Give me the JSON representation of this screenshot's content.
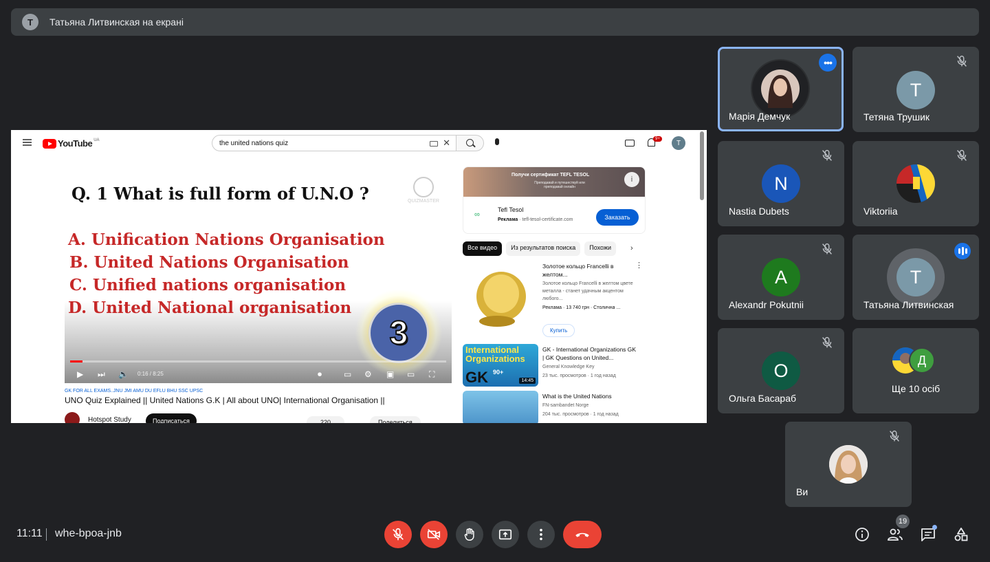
{
  "presenter": {
    "initial": "Т",
    "text": "Татьяна Литвинская на екрані"
  },
  "youtube": {
    "logo": "YouTube",
    "region": "UA",
    "search_query": "the united nations quiz",
    "notification_count": "9+",
    "avatar_initial": "T",
    "video": {
      "question": "Q. 1 What is full form of U.N.O ?",
      "options": [
        "A. Unification  Nations Organisation",
        "B. United Nations Organisation",
        "C. Unified nations organisation",
        "D. United National organisation"
      ],
      "watermark": "QUIZMASTER",
      "timer": "3",
      "time": "0:16 / 8:25",
      "progress": 0.032
    },
    "meta": {
      "tags": "GK FOR ALL EXAMS..JNU JMI AMU DU EFLU BHU SSC UPSC",
      "title": "UNO Quiz Explained || United Nations G.K | All about UNO| International Organisation ||",
      "channel": "Hotspot Study",
      "subscribe": "Подписаться",
      "likes": "220",
      "share": "Поделиться"
    },
    "ad": {
      "banner_title": "Получи сертификат TEFL TESOL",
      "banner_sub": "Преподавай и путешествуй или преподавай онлайн",
      "name": "Tefl Tesol",
      "label": "Реклама",
      "url": "tefl-tesol-certificate.com",
      "button": "Заказать"
    },
    "chips": [
      "Все видео",
      "Из результатов поиска",
      "Похожи"
    ],
    "recs": [
      {
        "title": "Золотое кольцо Francelli в желтом...",
        "desc": "Золотое кольцо Francelli в желтом цвете металла - станет удачным акцентом любого...",
        "meta": "Реклама · 13 740 грн · Столична ...",
        "button": "Купить"
      },
      {
        "title": "GK - International Organizations GK | GK Questions on United...",
        "channel": "General Knowledge Key",
        "meta": "23 тыс. просмотров · 1 год назад",
        "thumb_text": "International Organizations",
        "thumb_gk": "GK",
        "thumb_badge": "90+",
        "duration": "14:45"
      },
      {
        "title": "What is the United Nations",
        "channel": "FN-sambandet Norge",
        "meta": "204 тыс. просмотров · 1 год назад"
      }
    ]
  },
  "participants": [
    {
      "name": "Марія Демчук",
      "type": "photo",
      "state": "more"
    },
    {
      "name": "Тетяна Трушик",
      "initial": "T",
      "color": "#7b99a8",
      "state": "muted"
    },
    {
      "name": "Nastia Dubets",
      "initial": "N",
      "color": "#1a56b8",
      "state": "muted"
    },
    {
      "name": "Viktoriia",
      "type": "flag",
      "state": "muted"
    },
    {
      "name": "Alexandr Pokutnii",
      "initial": "A",
      "color": "#1e7a1e",
      "state": "muted"
    },
    {
      "name": "Татьяна Литвинская",
      "initial": "T",
      "color": "#7b99a8",
      "state": "speaking"
    },
    {
      "name": "Ольга Басараб",
      "initial": "O",
      "color": "#0f5a43",
      "state": "muted"
    },
    {
      "name": "Ще 10 осіб",
      "type": "more",
      "initial": "Д",
      "state": "none"
    },
    {
      "name": "Ви",
      "type": "photo",
      "state": "muted"
    }
  ],
  "bottom_bar": {
    "time": "11:11",
    "meeting_code": "whe-bpoa-jnb",
    "participant_count": "19"
  },
  "colors": {
    "background": "#202124",
    "tile": "#3c4043",
    "danger": "#ea4335",
    "accent": "#8ab4f8"
  }
}
